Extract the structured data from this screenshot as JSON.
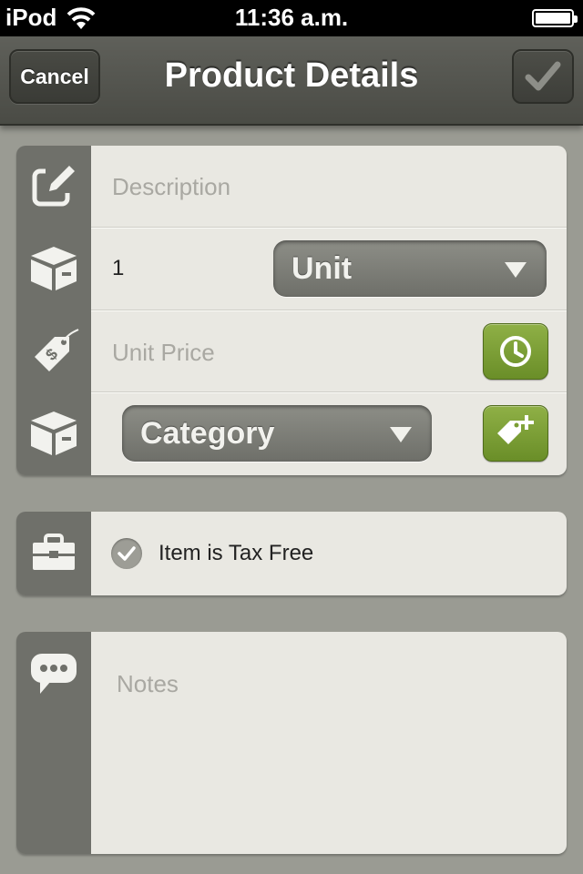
{
  "status_bar": {
    "carrier": "iPod",
    "time": "11:36 a.m.",
    "battery_level": 0.9
  },
  "nav": {
    "title": "Product Details",
    "cancel_label": "Cancel",
    "done_icon": "checkmark-icon"
  },
  "form": {
    "description": {
      "placeholder": "Description",
      "icon": "edit-icon"
    },
    "quantity": {
      "value": "1",
      "icon": "box-icon"
    },
    "unit_select": {
      "selected": "Unit"
    },
    "unit_price": {
      "placeholder": "Unit Price",
      "icon": "price-tag-icon",
      "history_icon": "clock-icon"
    },
    "category_select": {
      "selected": "Category",
      "icon": "box-icon",
      "add_icon": "add-tag-icon"
    }
  },
  "tax": {
    "label": "Item is Tax Free",
    "checked": true,
    "icon": "briefcase-icon"
  },
  "notes": {
    "placeholder": "Notes",
    "icon": "speech-bubble-icon"
  },
  "colors": {
    "accent_green": "#7a9e34",
    "nav_bg": "#55564f",
    "panel_bg": "#e9e8e2",
    "side_bg": "#6f706a"
  }
}
